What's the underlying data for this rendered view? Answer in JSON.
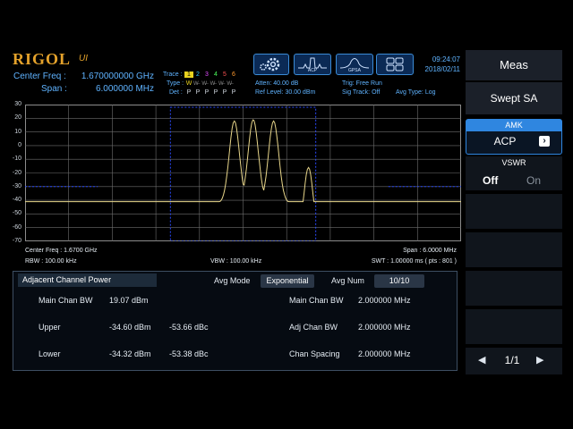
{
  "brand": {
    "logo": "RIGOL",
    "mark": "UI"
  },
  "header": {
    "center_freq_label": "Center Freq :",
    "center_freq_value": "1.670000000 GHz",
    "span_label": "Span :",
    "span_value": "6.000000 MHz",
    "trace_label": "Trace :",
    "trace_numbers": [
      "1",
      "2",
      "3",
      "4",
      "5",
      "6"
    ],
    "type_label": "Type :",
    "type_values": "W",
    "det_label": "Det :",
    "det_values": [
      "P",
      "P",
      "P",
      "P",
      "P",
      "P"
    ],
    "atten": "Atten: 40.00 dB",
    "ref_level": "Ref Level: 30.00 dBm",
    "trig": "Trig: Free Run",
    "sig_track": "Sig Track: Off",
    "avg_type": "Avg Type: Log",
    "time": "09:24:07",
    "date": "2018/02/11",
    "icons": [
      {
        "name": "gear-icon",
        "label": ""
      },
      {
        "name": "acp-icon",
        "label": "ACP"
      },
      {
        "name": "gpsa-icon",
        "label": "GPSA"
      },
      {
        "name": "layout-icon",
        "label": ""
      }
    ]
  },
  "plot": {
    "y_ticks": [
      "30",
      "20",
      "10",
      "0",
      "-10",
      "-20",
      "-30",
      "-40",
      "-50",
      "-60",
      "-70"
    ],
    "center_freq": "Center Freq : 1.6700 GHz",
    "span": "Span : 6.0000 MHz",
    "rbw": "RBW : 100.00 kHz",
    "vbw": "VBW : 100.00 kHz",
    "swt": "SWT : 1.00000 ms ( pts : 801 )",
    "trace_color": "#e8d68a",
    "marker_color": "#2b4bff",
    "y_range": [
      -70,
      30
    ],
    "x_range_mhz": [
      1667,
      1673
    ]
  },
  "results": {
    "title": "Adjacent Channel Power",
    "avg_mode_label": "Avg Mode",
    "avg_mode_value": "Exponential",
    "avg_num_label": "Avg Num",
    "avg_num_value": "10/10",
    "main_chan_bw_label": "Main Chan BW",
    "main_chan_bw_power": "19.07 dBm",
    "upper_label": "Upper",
    "upper_dbm": "-34.60 dBm",
    "upper_dbc": "-53.66 dBc",
    "lower_label": "Lower",
    "lower_dbm": "-34.32 dBm",
    "lower_dbc": "-53.38 dBc",
    "cfg_main_bw_label": "Main Chan BW",
    "cfg_main_bw_value": "2.000000 MHz",
    "cfg_adj_bw_label": "Adj Chan BW",
    "cfg_adj_bw_value": "2.000000 MHz",
    "cfg_spacing_label": "Chan Spacing",
    "cfg_spacing_value": "2.000000 MHz"
  },
  "menu": {
    "title": "Meas",
    "mode": "Swept SA",
    "amk_label": "AMK",
    "amk_value": "ACP",
    "vswr_label": "VSWR",
    "vswr_off": "Off",
    "vswr_on": "On",
    "page": "1/1"
  }
}
